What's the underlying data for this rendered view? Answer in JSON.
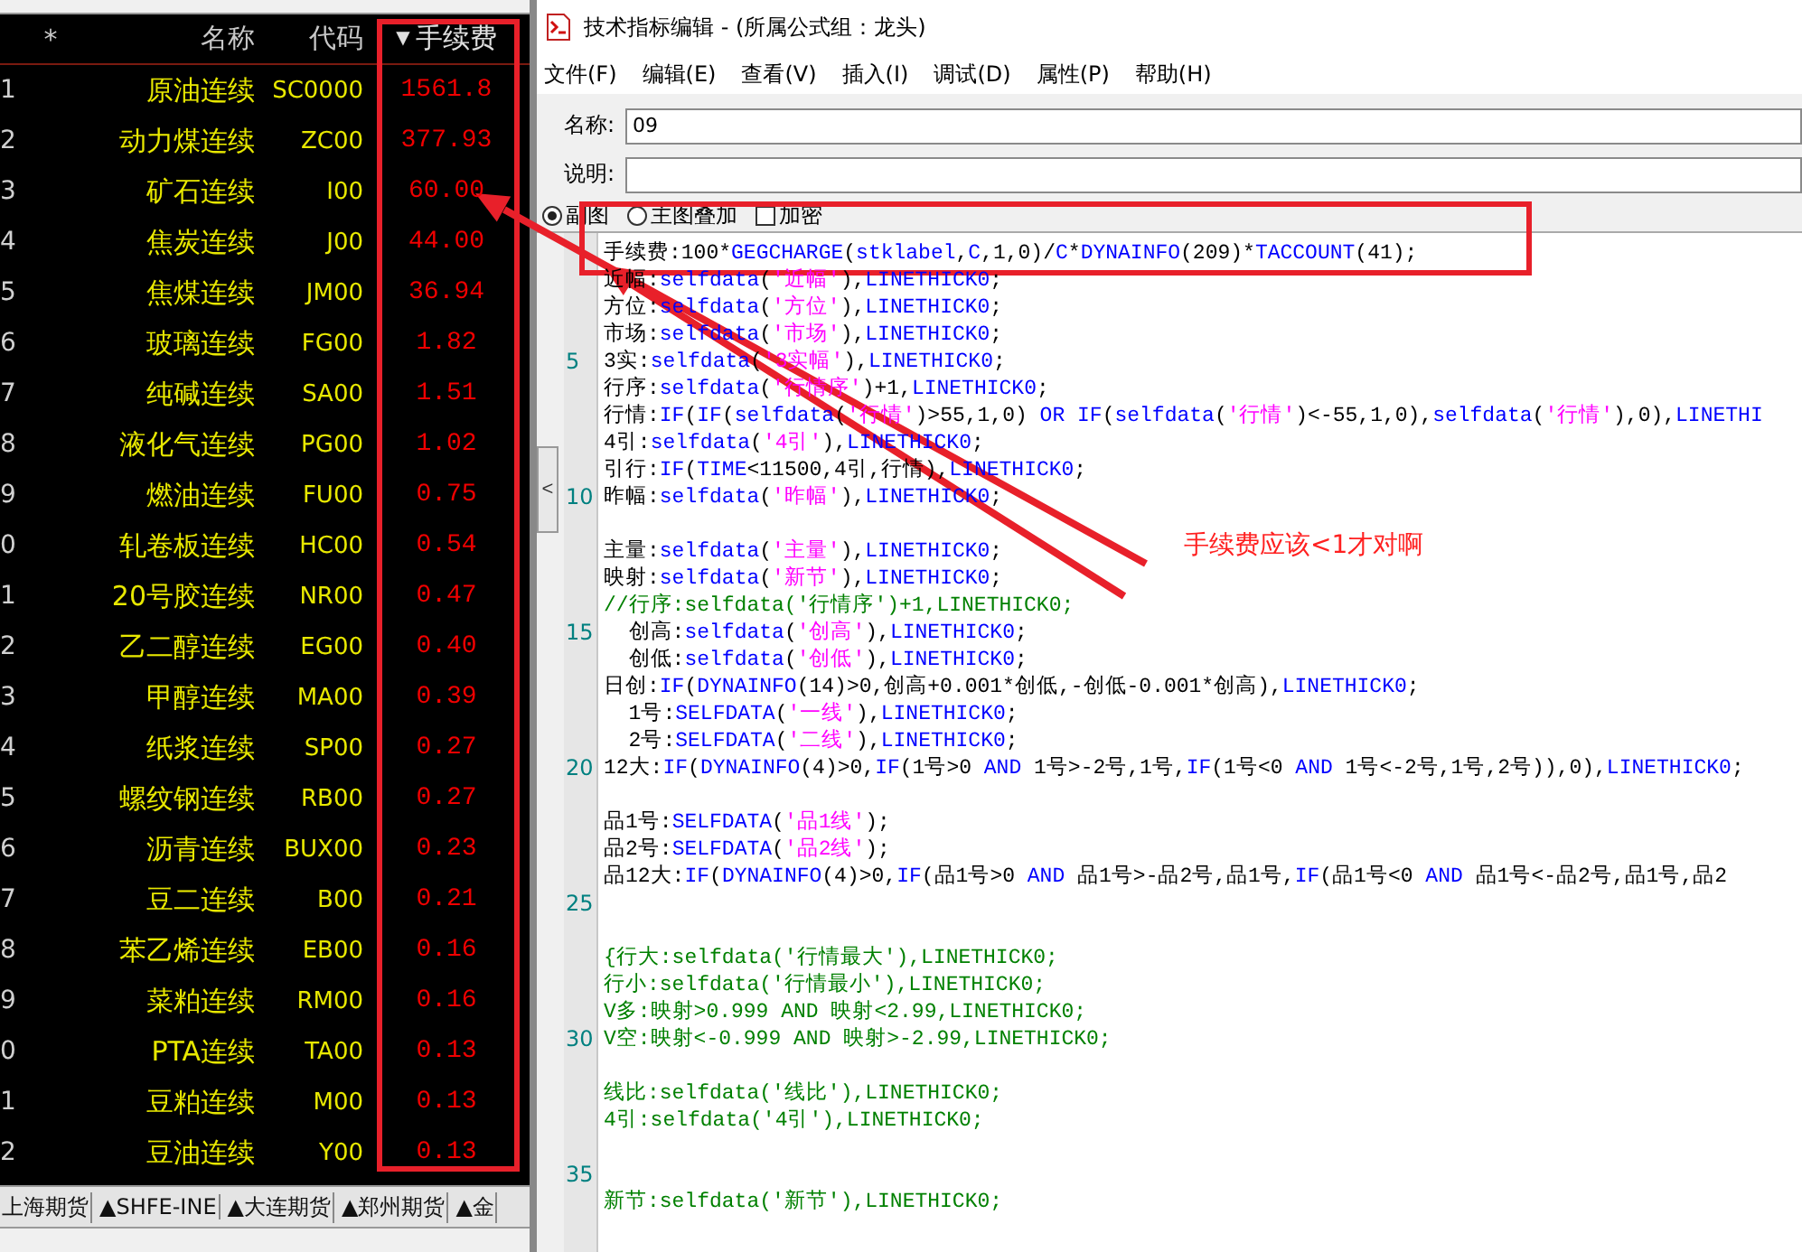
{
  "quote_table": {
    "columns": [
      "*",
      "名称",
      "代码",
      "手续费"
    ],
    "sort_mark": "▼",
    "rows": [
      {
        "index": "1",
        "name": "原油连续",
        "code": "SC0000",
        "fee": "1561.8"
      },
      {
        "index": "2",
        "name": "动力煤连续",
        "code": "ZC00",
        "fee": "377.93"
      },
      {
        "index": "3",
        "name": "矿石连续",
        "code": "I00",
        "fee": "60.00"
      },
      {
        "index": "4",
        "name": "焦炭连续",
        "code": "J00",
        "fee": "44.00"
      },
      {
        "index": "5",
        "name": "焦煤连续",
        "code": "JM00",
        "fee": "36.94"
      },
      {
        "index": "6",
        "name": "玻璃连续",
        "code": "FG00",
        "fee": "1.82"
      },
      {
        "index": "7",
        "name": "纯碱连续",
        "code": "SA00",
        "fee": "1.51"
      },
      {
        "index": "8",
        "name": "液化气连续",
        "code": "PG00",
        "fee": "1.02"
      },
      {
        "index": "9",
        "name": "燃油连续",
        "code": "FU00",
        "fee": "0.75"
      },
      {
        "index": "0",
        "name": "轧卷板连续",
        "code": "HC00",
        "fee": "0.54"
      },
      {
        "index": "1",
        "name": "20号胶连续",
        "code": "NR00",
        "fee": "0.47"
      },
      {
        "index": "2",
        "name": "乙二醇连续",
        "code": "EG00",
        "fee": "0.40"
      },
      {
        "index": "3",
        "name": "甲醇连续",
        "code": "MA00",
        "fee": "0.39"
      },
      {
        "index": "4",
        "name": "纸浆连续",
        "code": "SP00",
        "fee": "0.27"
      },
      {
        "index": "5",
        "name": "螺纹钢连续",
        "code": "RB00",
        "fee": "0.27"
      },
      {
        "index": "6",
        "name": "沥青连续",
        "code": "BUX00",
        "fee": "0.23"
      },
      {
        "index": "7",
        "name": "豆二连续",
        "code": "B00",
        "fee": "0.21"
      },
      {
        "index": "8",
        "name": "苯乙烯连续",
        "code": "EB00",
        "fee": "0.16"
      },
      {
        "index": "9",
        "name": "菜粕连续",
        "code": "RM00",
        "fee": "0.16"
      },
      {
        "index": "0",
        "name": "PTA连续",
        "code": "TA00",
        "fee": "0.13"
      },
      {
        "index": "1",
        "name": "豆粕连续",
        "code": "M00",
        "fee": "0.13"
      },
      {
        "index": "2",
        "name": "豆油连续",
        "code": "Y00",
        "fee": "0.13"
      }
    ]
  },
  "market_tabs": [
    {
      "label": "上海期货"
    },
    {
      "label": "▲SHFE-INE"
    },
    {
      "label": "▲大连期货"
    },
    {
      "label": "▲郑州期货"
    },
    {
      "label": "▲金"
    }
  ],
  "editor_window": {
    "title": "技术指标编辑 - (所属公式组：龙头)",
    "menu": [
      "文件(F)",
      "编辑(E)",
      "查看(V)",
      "插入(I)",
      "调试(D)",
      "属性(P)",
      "帮助(H)"
    ],
    "name_label": "名称:",
    "name_value": "09",
    "description_label": "说明:",
    "options": [
      {
        "kind": "radio",
        "label": "副图",
        "checked": true
      },
      {
        "kind": "radio",
        "label": "主图叠加",
        "checked": false
      },
      {
        "kind": "checkbox",
        "label": "加密",
        "checked": false
      }
    ],
    "collapse_button": "<",
    "code_blocks": [
      [
        {
          "segments": [
            {
              "kind": "text",
              "text": "手续费:100*"
            },
            {
              "kind": "func",
              "text": "GEGCHARGE"
            },
            {
              "kind": "text",
              "text": "("
            },
            {
              "kind": "func",
              "text": "stklabel"
            },
            {
              "kind": "text",
              "text": ","
            },
            {
              "kind": "func",
              "text": "C"
            },
            {
              "kind": "text",
              "text": ",1,0)/"
            },
            {
              "kind": "func",
              "text": "C"
            },
            {
              "kind": "text",
              "text": "*"
            },
            {
              "kind": "func",
              "text": "DYNAINFO"
            },
            {
              "kind": "text",
              "text": "(209)*"
            },
            {
              "kind": "func",
              "text": "TACCOUNT"
            },
            {
              "kind": "text",
              "text": "(41);"
            }
          ]
        },
        {
          "segments": [
            {
              "kind": "text",
              "text": "近幅:"
            },
            {
              "kind": "func",
              "text": "selfdata"
            },
            {
              "kind": "text",
              "text": "("
            },
            {
              "kind": "string",
              "text": "'近幅'"
            },
            {
              "kind": "text",
              "text": "),"
            },
            {
              "kind": "func",
              "text": "LINETHICK0"
            },
            {
              "kind": "text",
              "text": ";"
            }
          ]
        },
        {
          "segments": [
            {
              "kind": "text",
              "text": "方位:"
            },
            {
              "kind": "func",
              "text": "selfdata"
            },
            {
              "kind": "text",
              "text": "("
            },
            {
              "kind": "string",
              "text": "'方位'"
            },
            {
              "kind": "text",
              "text": "),"
            },
            {
              "kind": "func",
              "text": "LINETHICK0"
            },
            {
              "kind": "text",
              "text": ";"
            }
          ]
        },
        {
          "segments": [
            {
              "kind": "text",
              "text": "市场:"
            },
            {
              "kind": "func",
              "text": "selfdata"
            },
            {
              "kind": "text",
              "text": "("
            },
            {
              "kind": "string",
              "text": "'市场'"
            },
            {
              "kind": "text",
              "text": "),"
            },
            {
              "kind": "func",
              "text": "LINETHICK0"
            },
            {
              "kind": "text",
              "text": ";"
            }
          ]
        },
        {
          "number": "5",
          "segments": [
            {
              "kind": "text",
              "text": "3实:"
            },
            {
              "kind": "func",
              "text": "selfdata"
            },
            {
              "kind": "text",
              "text": "("
            },
            {
              "kind": "string",
              "text": "'3实幅'"
            },
            {
              "kind": "text",
              "text": "),"
            },
            {
              "kind": "func",
              "text": "LINETHICK0"
            },
            {
              "kind": "text",
              "text": ";"
            }
          ]
        },
        {
          "segments": [
            {
              "kind": "text",
              "text": "行序:"
            },
            {
              "kind": "func",
              "text": "selfdata"
            },
            {
              "kind": "text",
              "text": "("
            },
            {
              "kind": "string",
              "text": "'行情序'"
            },
            {
              "kind": "text",
              "text": ")+1,"
            },
            {
              "kind": "func",
              "text": "LINETHICK0"
            },
            {
              "kind": "text",
              "text": ";"
            }
          ]
        },
        {
          "segments": [
            {
              "kind": "text",
              "text": "行情:"
            },
            {
              "kind": "func",
              "text": "IF"
            },
            {
              "kind": "text",
              "text": "("
            },
            {
              "kind": "func",
              "text": "IF"
            },
            {
              "kind": "text",
              "text": "("
            },
            {
              "kind": "func",
              "text": "selfdata"
            },
            {
              "kind": "text",
              "text": "("
            },
            {
              "kind": "string",
              "text": "'行情'"
            },
            {
              "kind": "text",
              "text": ")>55,1,0) "
            },
            {
              "kind": "func",
              "text": "OR IF"
            },
            {
              "kind": "text",
              "text": "("
            },
            {
              "kind": "func",
              "text": "selfdata"
            },
            {
              "kind": "text",
              "text": "("
            },
            {
              "kind": "string",
              "text": "'行情'"
            },
            {
              "kind": "text",
              "text": ")<-55,1,0),"
            },
            {
              "kind": "func",
              "text": "selfdata"
            },
            {
              "kind": "text",
              "text": "("
            },
            {
              "kind": "string",
              "text": "'行情'"
            },
            {
              "kind": "text",
              "text": "),0),"
            },
            {
              "kind": "func",
              "text": "LINETHI"
            }
          ]
        },
        {
          "segments": [
            {
              "kind": "text",
              "text": "4引:"
            },
            {
              "kind": "func",
              "text": "selfdata"
            },
            {
              "kind": "text",
              "text": "("
            },
            {
              "kind": "string",
              "text": "'4引'"
            },
            {
              "kind": "text",
              "text": "),"
            },
            {
              "kind": "func",
              "text": "LINETHICK0"
            },
            {
              "kind": "text",
              "text": ";"
            }
          ]
        },
        {
          "segments": [
            {
              "kind": "text",
              "text": "引行:"
            },
            {
              "kind": "func",
              "text": "IF"
            },
            {
              "kind": "text",
              "text": "("
            },
            {
              "kind": "func",
              "text": "TIME"
            },
            {
              "kind": "text",
              "text": "<11500,4引,行情),"
            },
            {
              "kind": "func",
              "text": "LINETHICK0"
            },
            {
              "kind": "text",
              "text": ";"
            }
          ]
        },
        {
          "number": "10",
          "segments": [
            {
              "kind": "text",
              "text": "昨幅:"
            },
            {
              "kind": "func",
              "text": "selfdata"
            },
            {
              "kind": "text",
              "text": "("
            },
            {
              "kind": "string",
              "text": "'昨幅'"
            },
            {
              "kind": "text",
              "text": "),"
            },
            {
              "kind": "func",
              "text": "LINETHICK0"
            },
            {
              "kind": "text",
              "text": ";"
            }
          ]
        }
      ],
      [
        {
          "segments": [
            {
              "kind": "text",
              "text": "主量:"
            },
            {
              "kind": "func",
              "text": "selfdata"
            },
            {
              "kind": "text",
              "text": "("
            },
            {
              "kind": "string",
              "text": "'主量'"
            },
            {
              "kind": "text",
              "text": "),"
            },
            {
              "kind": "func",
              "text": "LINETHICK0"
            },
            {
              "kind": "text",
              "text": ";"
            }
          ]
        },
        {
          "segments": [
            {
              "kind": "text",
              "text": "映射:"
            },
            {
              "kind": "func",
              "text": "selfdata"
            },
            {
              "kind": "text",
              "text": "("
            },
            {
              "kind": "string",
              "text": "'新节'"
            },
            {
              "kind": "text",
              "text": "),"
            },
            {
              "kind": "func",
              "text": "LINETHICK0"
            },
            {
              "kind": "text",
              "text": ";"
            }
          ]
        },
        {
          "segments": [
            {
              "kind": "comment",
              "text": "//行序:selfdata('行情序')+1,LINETHICK0;"
            }
          ]
        },
        {
          "number": "15",
          "segments": [
            {
              "kind": "text",
              "text": "  创高:"
            },
            {
              "kind": "func",
              "text": "selfdata"
            },
            {
              "kind": "text",
              "text": "("
            },
            {
              "kind": "string",
              "text": "'创高'"
            },
            {
              "kind": "text",
              "text": "),"
            },
            {
              "kind": "func",
              "text": "LINETHICK0"
            },
            {
              "kind": "text",
              "text": ";"
            }
          ]
        },
        {
          "segments": [
            {
              "kind": "text",
              "text": "  创低:"
            },
            {
              "kind": "func",
              "text": "selfdata"
            },
            {
              "kind": "text",
              "text": "("
            },
            {
              "kind": "string",
              "text": "'创低'"
            },
            {
              "kind": "text",
              "text": "),"
            },
            {
              "kind": "func",
              "text": "LINETHICK0"
            },
            {
              "kind": "text",
              "text": ";"
            }
          ]
        },
        {
          "segments": [
            {
              "kind": "text",
              "text": "日创:"
            },
            {
              "kind": "func",
              "text": "IF"
            },
            {
              "kind": "text",
              "text": "("
            },
            {
              "kind": "func",
              "text": "DYNAINFO"
            },
            {
              "kind": "text",
              "text": "(14)>0,创高+0.001*创低,-创低-0.001*创高),"
            },
            {
              "kind": "func",
              "text": "LINETHICK0"
            },
            {
              "kind": "text",
              "text": ";"
            }
          ]
        },
        {
          "segments": [
            {
              "kind": "text",
              "text": "  1号:"
            },
            {
              "kind": "func",
              "text": "SELFDATA"
            },
            {
              "kind": "text",
              "text": "("
            },
            {
              "kind": "string",
              "text": "'一线'"
            },
            {
              "kind": "text",
              "text": "),"
            },
            {
              "kind": "func",
              "text": "LINETHICK0"
            },
            {
              "kind": "text",
              "text": ";"
            }
          ]
        },
        {
          "segments": [
            {
              "kind": "text",
              "text": "  2号:"
            },
            {
              "kind": "func",
              "text": "SELFDATA"
            },
            {
              "kind": "text",
              "text": "("
            },
            {
              "kind": "string",
              "text": "'二线'"
            },
            {
              "kind": "text",
              "text": "),"
            },
            {
              "kind": "func",
              "text": "LINETHICK0"
            },
            {
              "kind": "text",
              "text": ";"
            }
          ]
        },
        {
          "number": "20",
          "segments": [
            {
              "kind": "text",
              "text": "12大:"
            },
            {
              "kind": "func",
              "text": "IF"
            },
            {
              "kind": "text",
              "text": "("
            },
            {
              "kind": "func",
              "text": "DYNAINFO"
            },
            {
              "kind": "text",
              "text": "(4)>0,"
            },
            {
              "kind": "func",
              "text": "IF"
            },
            {
              "kind": "text",
              "text": "(1号>0 "
            },
            {
              "kind": "func",
              "text": "AND"
            },
            {
              "kind": "text",
              "text": " 1号>-2号,1号,"
            },
            {
              "kind": "func",
              "text": "IF"
            },
            {
              "kind": "text",
              "text": "(1号<0 "
            },
            {
              "kind": "func",
              "text": "AND"
            },
            {
              "kind": "text",
              "text": " 1号<-2号,1号,2号)),0),"
            },
            {
              "kind": "func",
              "text": "LINETHICK0"
            },
            {
              "kind": "text",
              "text": ";"
            }
          ]
        }
      ],
      [
        {
          "segments": [
            {
              "kind": "text",
              "text": "品1号:"
            },
            {
              "kind": "func",
              "text": "SELFDATA"
            },
            {
              "kind": "text",
              "text": "("
            },
            {
              "kind": "string",
              "text": "'品1线'"
            },
            {
              "kind": "text",
              "text": ");"
            }
          ]
        },
        {
          "segments": [
            {
              "kind": "text",
              "text": "品2号:"
            },
            {
              "kind": "func",
              "text": "SELFDATA"
            },
            {
              "kind": "text",
              "text": "("
            },
            {
              "kind": "string",
              "text": "'品2线'"
            },
            {
              "kind": "text",
              "text": ");"
            }
          ]
        },
        {
          "segments": [
            {
              "kind": "text",
              "text": "品12大:"
            },
            {
              "kind": "func",
              "text": "IF"
            },
            {
              "kind": "text",
              "text": "("
            },
            {
              "kind": "func",
              "text": "DYNAINFO"
            },
            {
              "kind": "text",
              "text": "(4)>0,"
            },
            {
              "kind": "func",
              "text": "IF"
            },
            {
              "kind": "text",
              "text": "(品1号>0 "
            },
            {
              "kind": "func",
              "text": "AND"
            },
            {
              "kind": "text",
              "text": " 品1号>-品2号,品1号,"
            },
            {
              "kind": "func",
              "text": "IF"
            },
            {
              "kind": "text",
              "text": "(品1号<0 "
            },
            {
              "kind": "func",
              "text": "AND"
            },
            {
              "kind": "text",
              "text": " 品1号<-品2号,品1号,品2"
            }
          ]
        },
        {
          "number": "25"
        }
      ],
      [
        {
          "segments": [
            {
              "kind": "comment",
              "text": "{行大:selfdata('行情最大'),LINETHICK0;"
            }
          ]
        },
        {
          "segments": [
            {
              "kind": "comment",
              "text": "行小:selfdata('行情最小'),LINETHICK0;"
            }
          ]
        },
        {
          "segments": [
            {
              "kind": "comment",
              "text": "V多:映射>0.999 AND 映射<2.99,LINETHICK0;"
            }
          ]
        },
        {
          "number": "30",
          "segments": [
            {
              "kind": "comment",
              "text": "V空:映射<-0.999 AND 映射>-2.99,LINETHICK0;"
            }
          ]
        }
      ],
      [
        {
          "segments": [
            {
              "kind": "comment",
              "text": "线比:selfdata('线比'),LINETHICK0;"
            }
          ]
        },
        {
          "segments": [
            {
              "kind": "comment",
              "text": "4引:selfdata('4引'),LINETHICK0;"
            }
          ]
        }
      ],
      [
        {
          "number": "35"
        },
        {
          "segments": [
            {
              "kind": "comment",
              "text": "新节:selfdata('新节'),LINETHICK0;"
            }
          ]
        }
      ]
    ]
  },
  "annotation": {
    "text": "手续费应该<1才对啊"
  }
}
